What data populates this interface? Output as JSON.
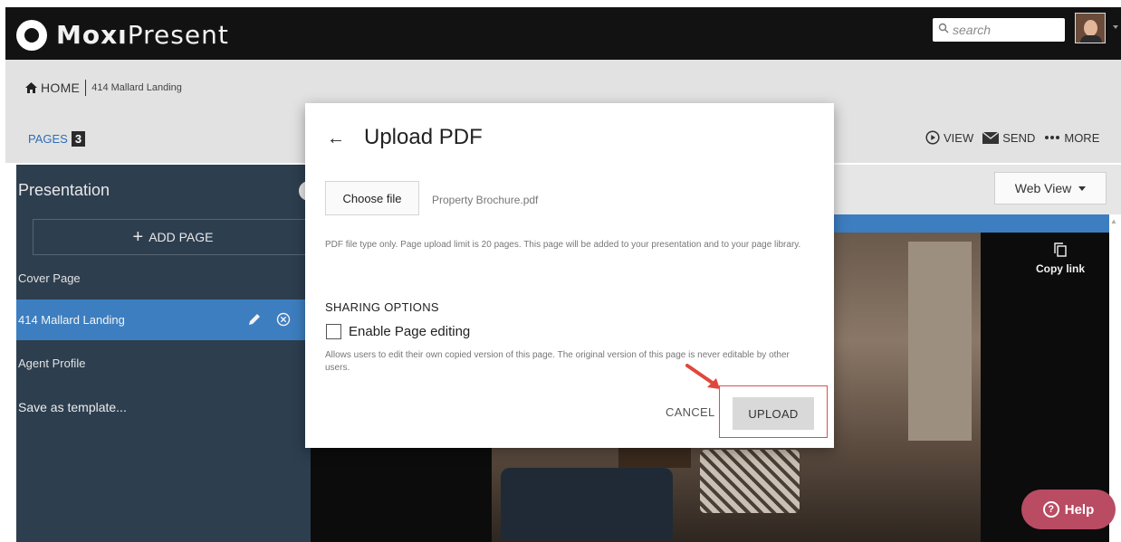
{
  "app": {
    "brand_bold": "Moxı",
    "brand_light": "Present"
  },
  "search": {
    "placeholder": "search"
  },
  "breadcrumb": {
    "home": "HOME",
    "current": "414 Mallard Landing"
  },
  "pages": {
    "label": "PAGES",
    "count": "3"
  },
  "actions": {
    "view": "VIEW",
    "send": "SEND",
    "more": "MORE"
  },
  "sidebar": {
    "title": "Presentation",
    "add_page": "ADD PAGE",
    "items": [
      {
        "label": "Cover Page"
      },
      {
        "label": "414 Mallard Landing"
      },
      {
        "label": "Agent Profile"
      }
    ],
    "save_template": "Save as template..."
  },
  "preview": {
    "view_select": "Web View",
    "copy_link": "Copy link",
    "help": "Help"
  },
  "modal": {
    "title": "Upload PDF",
    "choose_file": "Choose file",
    "file_name": "Property Brochure.pdf",
    "hint": "PDF file type only. Page upload limit is 20 pages. This page will be added to your presentation and to your page library.",
    "sharing_heading": "SHARING OPTIONS",
    "enable_editing": "Enable Page editing",
    "enable_editing_checked": false,
    "allows_text": "Allows users to edit their own copied version of this page. The original version of this page is never editable by other users.",
    "cancel": "CANCEL",
    "upload": "UPLOAD"
  },
  "colors": {
    "topbar": "#121212",
    "sidebar": "#2d3e4f",
    "active_item": "#3d7ec0",
    "accent_blue": "#2c6fb7",
    "help": "#b94b63",
    "highlight": "#d0534b"
  }
}
